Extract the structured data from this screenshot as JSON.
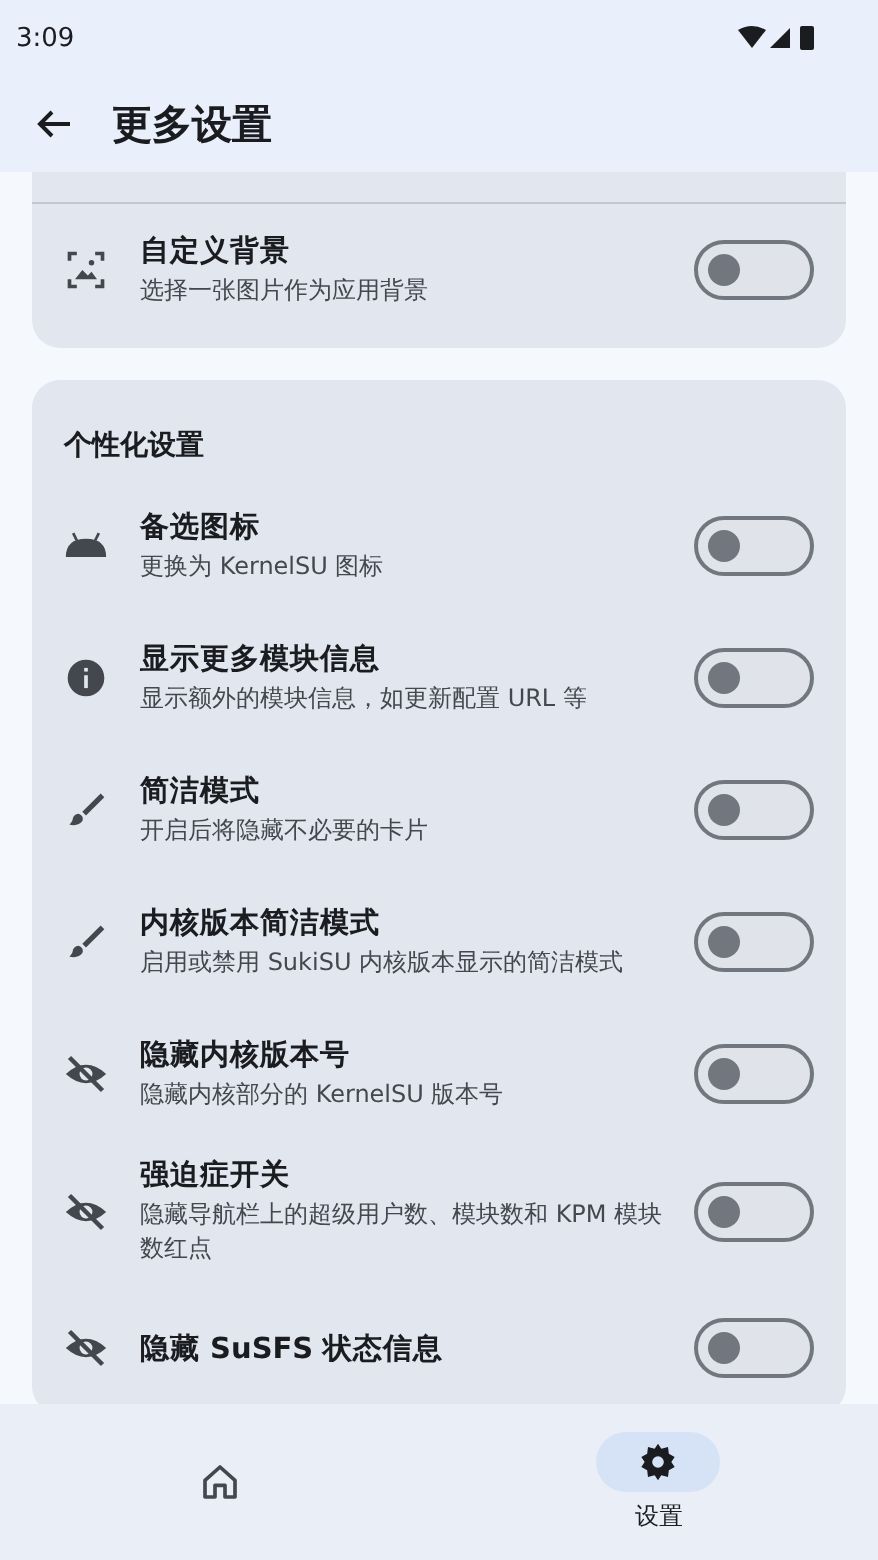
{
  "status_bar": {
    "time": "3:09"
  },
  "top_bar": {
    "title": "更多设置"
  },
  "cards": [
    {
      "items": [
        {
          "kind": "image",
          "title": "自定义背景",
          "subtitle": "选择一张图片作为应用背景",
          "on": false
        }
      ]
    },
    {
      "header": "个性化设置",
      "items": [
        {
          "kind": "android",
          "title": "备选图标",
          "subtitle": "更换为 KernelSU 图标",
          "on": false
        },
        {
          "kind": "info",
          "title": "显示更多模块信息",
          "subtitle": "显示额外的模块信息，如更新配置 URL 等",
          "on": false
        },
        {
          "kind": "brush",
          "title": "简洁模式",
          "subtitle": "开启后将隐藏不必要的卡片",
          "on": false
        },
        {
          "kind": "brush",
          "title": "内核版本简洁模式",
          "subtitle": "启用或禁用 SukiSU 内核版本显示的简洁模式",
          "on": false
        },
        {
          "kind": "eye_off",
          "title": "隐藏内核版本号",
          "subtitle": "隐藏内核部分的 KernelSU 版本号",
          "on": false
        },
        {
          "kind": "eye_off",
          "title": "强迫症开关",
          "subtitle": "隐藏导航栏上的超级用户数、模块数和 KPM 模块数红点",
          "on": false
        },
        {
          "kind": "eye_off",
          "title": "隐藏 SuSFS 状态信息",
          "on": false
        }
      ]
    }
  ],
  "nav": [
    {
      "kind": "home",
      "selected": false
    },
    {
      "kind": "settings",
      "label": "设置",
      "selected": true
    }
  ]
}
